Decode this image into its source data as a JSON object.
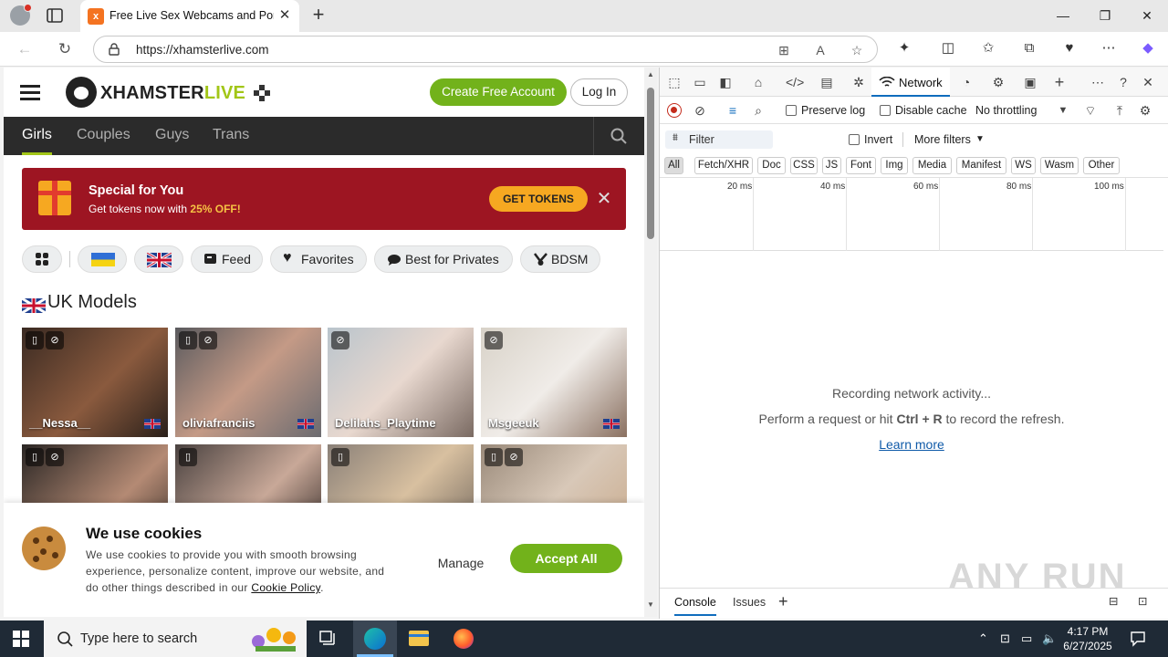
{
  "browser": {
    "tab_title": "Free Live Sex Webcams and Porn",
    "url": "https://xhamsterlive.com",
    "new_tab_symbol": "+"
  },
  "site": {
    "logo_x": "XHAMSTER",
    "logo_live": "LIVE",
    "create_account": "Create Free Account",
    "login": "Log In",
    "categories": [
      "Girls",
      "Couples",
      "Guys",
      "Trans"
    ],
    "promo": {
      "title": "Special for You",
      "sub_prefix": "Get tokens now with ",
      "sub_highlight": "25% OFF!",
      "button": "GET TOKENS"
    },
    "chips": {
      "feed": "Feed",
      "favorites": "Favorites",
      "best_for_privates": "Best for Privates",
      "bdsm": "BDSM"
    },
    "section_title": "UK Models",
    "models": [
      "__Nessa__",
      "oliviafranciis",
      "Delilahs_Playtime",
      "Msgeeuk"
    ],
    "cookie": {
      "title": "We use cookies",
      "text": "We use cookies to provide you with smooth browsing experience, personalize content, improve our website, and do other things described in our",
      "link": "Cookie Policy",
      "period": ".",
      "manage": "Manage",
      "accept": "Accept All"
    }
  },
  "devtools": {
    "active_tab": "Network",
    "preserve_log": "Preserve log",
    "disable_cache": "Disable cache",
    "throttling": "No throttling",
    "filter_placeholder": "Filter",
    "invert": "Invert",
    "more_filters": "More filters",
    "types": [
      "All",
      "Fetch/XHR",
      "Doc",
      "CSS",
      "JS",
      "Font",
      "Img",
      "Media",
      "Manifest",
      "WS",
      "Wasm",
      "Other"
    ],
    "timeline_labels": [
      "20 ms",
      "40 ms",
      "60 ms",
      "80 ms",
      "100 ms"
    ],
    "empty_line1": "Recording network activity...",
    "empty_line2_prefix": "Perform a request or hit ",
    "empty_line2_keys": "Ctrl + R",
    "empty_line2_suffix": " to record the refresh.",
    "learn_more": "Learn more",
    "drawer_tabs": [
      "Console",
      "Issues"
    ]
  },
  "watermark": "ANY RUN",
  "taskbar": {
    "search_placeholder": "Type here to search",
    "time": "4:17 PM",
    "date": "6/27/2025"
  },
  "colors": {
    "brand_green": "#72b21b",
    "promo_red": "#9d1522",
    "token_orange": "#f6a821",
    "devtools_accent": "#0f6cbd"
  }
}
